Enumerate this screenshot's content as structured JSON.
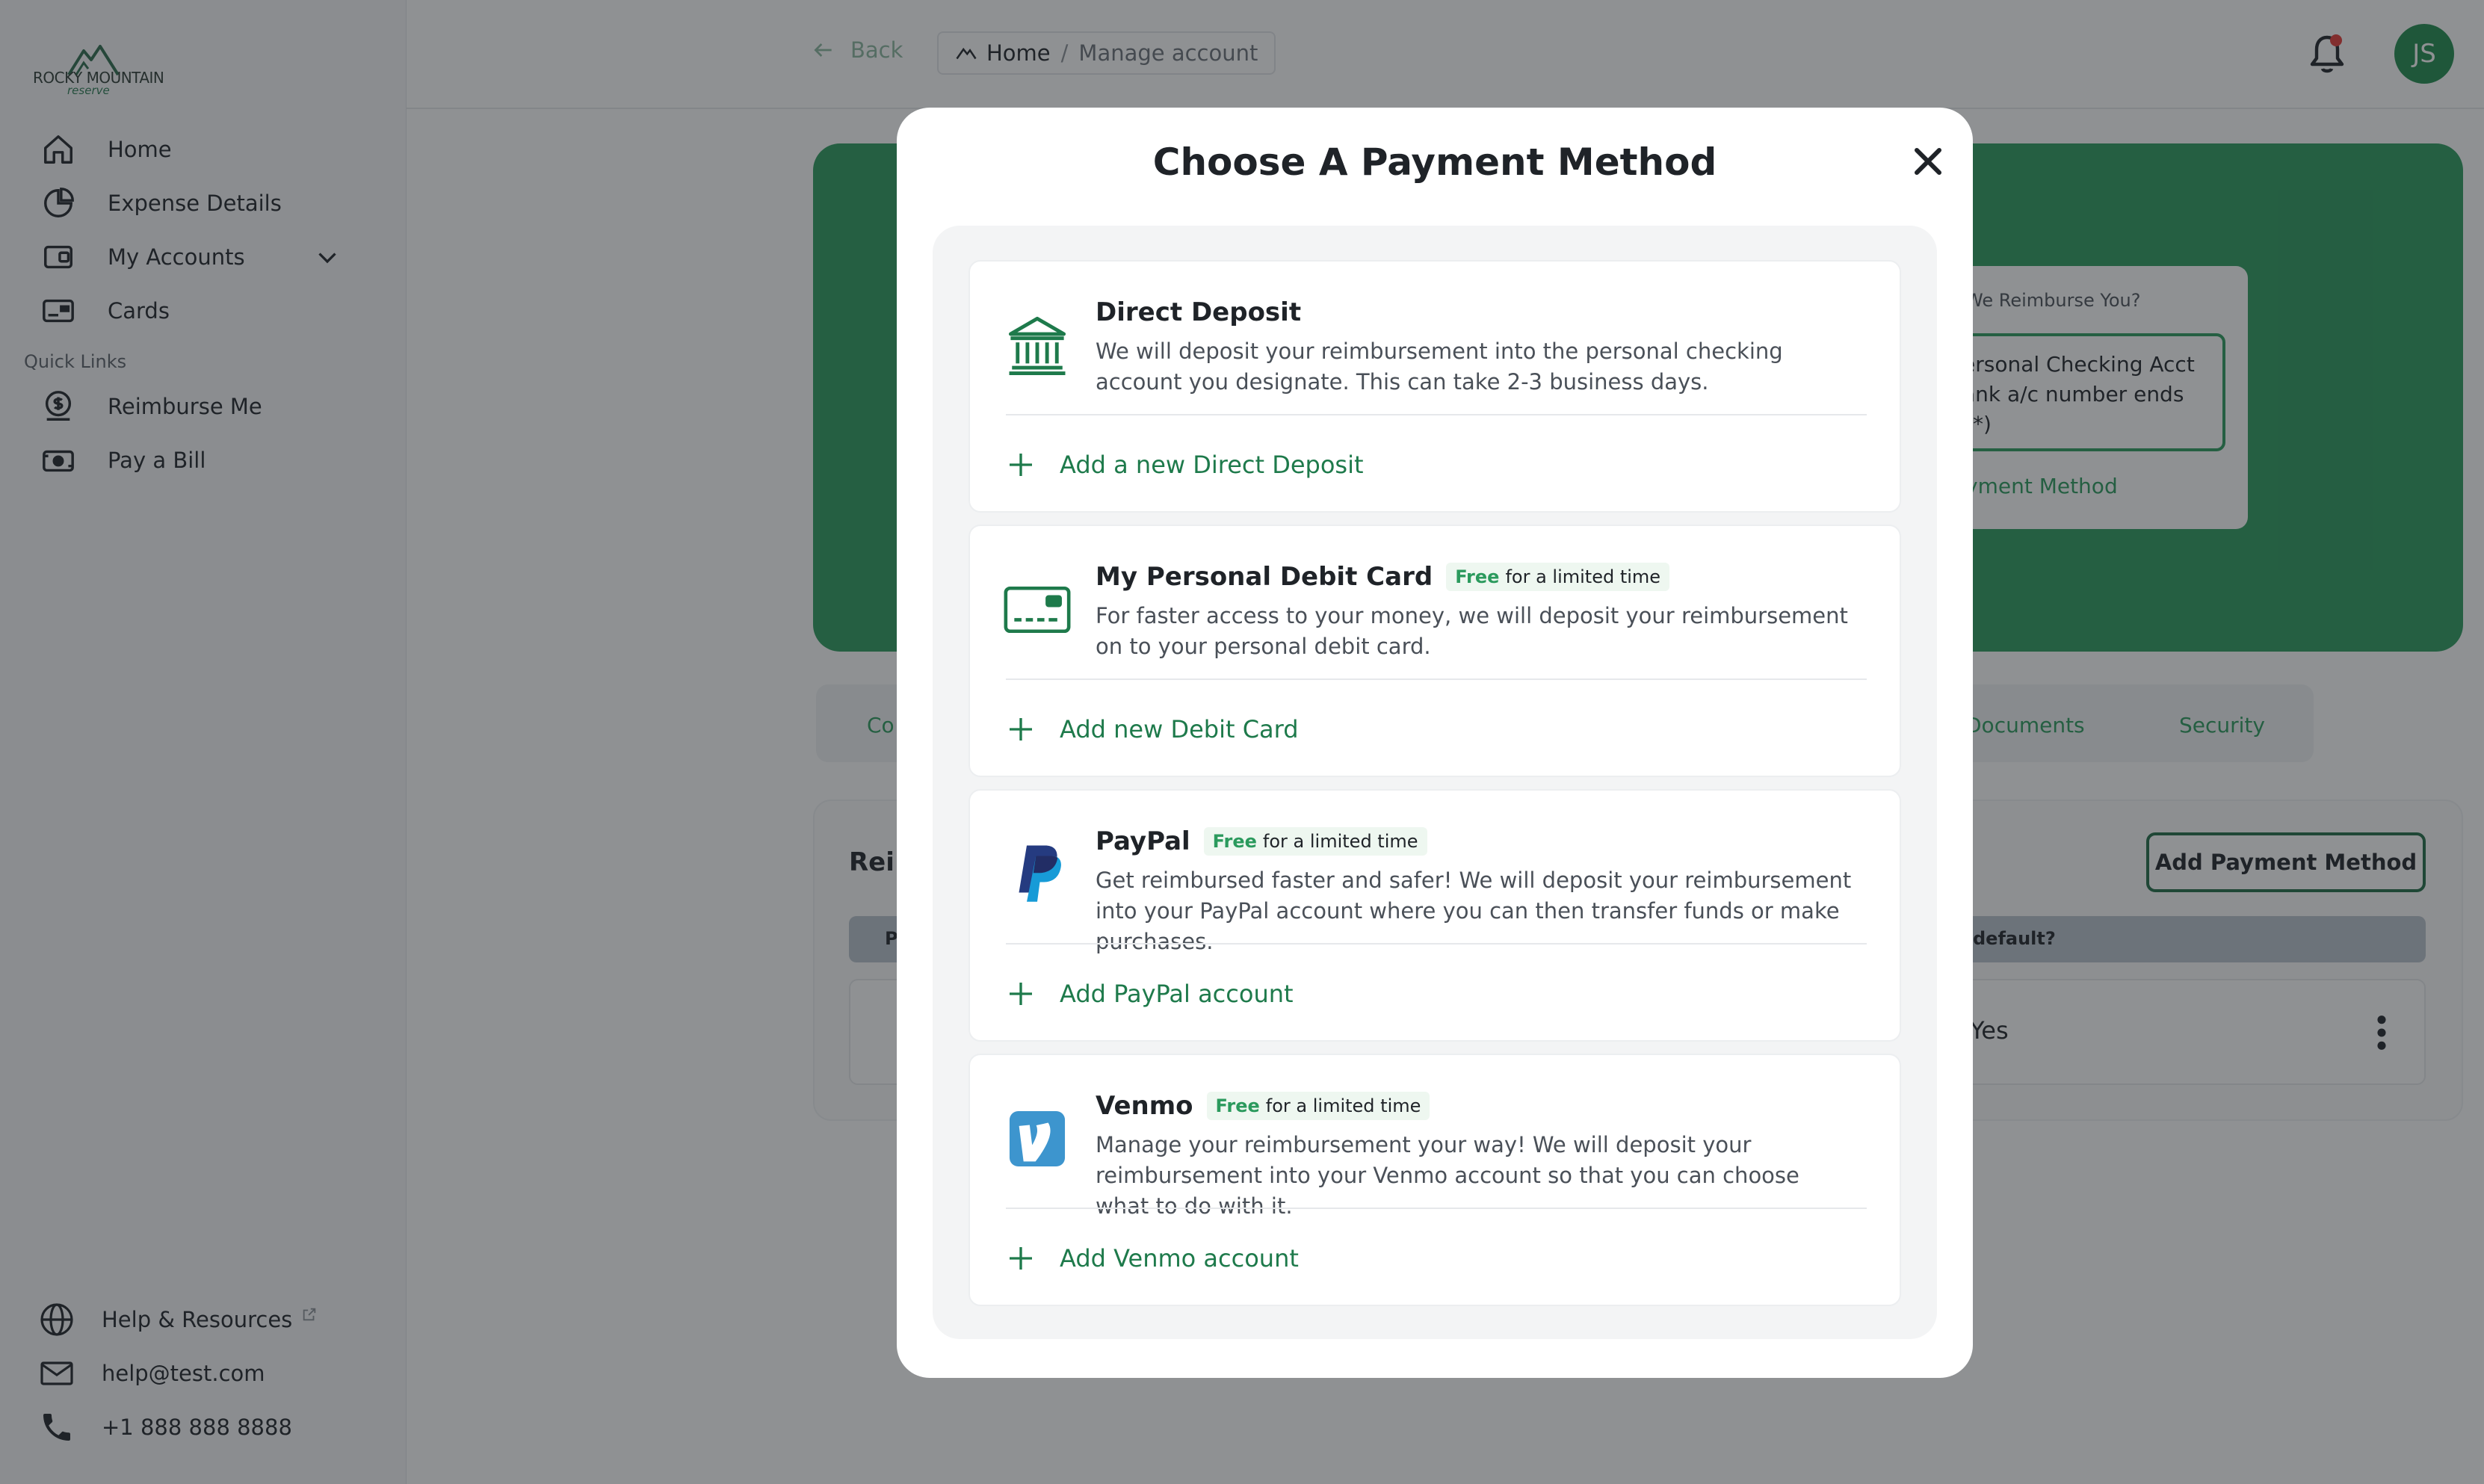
{
  "brand": {
    "name": "ROCKY MOUNTAIN",
    "tagline": "reserve"
  },
  "sidebar": {
    "items": [
      {
        "label": "Home",
        "icon": "home-icon"
      },
      {
        "label": "Expense Details",
        "icon": "pie-chart-icon"
      },
      {
        "label": "My Accounts",
        "icon": "wallet-icon"
      },
      {
        "label": "Cards",
        "icon": "card-icon"
      }
    ],
    "quick_links_title": "Quick Links",
    "quick_links": [
      {
        "label": "Reimburse Me",
        "icon": "dollar-coin-icon"
      },
      {
        "label": "Pay a Bill",
        "icon": "bill-icon"
      }
    ],
    "bottom": [
      {
        "label": "Help & Resources",
        "icon": "globe-icon"
      },
      {
        "label": "help@test.com",
        "icon": "mail-icon"
      },
      {
        "label": "+1 888 888 8888",
        "icon": "phone-icon"
      }
    ]
  },
  "topbar": {
    "back_label": "Back",
    "breadcrumb": {
      "home": "Home",
      "separator": "/",
      "current": "Manage account"
    },
    "avatar_initials": "JS"
  },
  "background": {
    "hero_question": "We Reimburse You?",
    "hero_account": "ersonal Checking Acct ank a/c number ends **)",
    "hero_link": "yment Method",
    "tabs": [
      "Co",
      "Documents",
      "Security"
    ],
    "panel_title": "Rei",
    "add_payment_button": "Add Payment Method",
    "table_header_left": "P",
    "table_header_default": "default?",
    "row_default_value": "Yes"
  },
  "modal": {
    "title": "Choose A Payment Method",
    "options": [
      {
        "name": "Direct Deposit",
        "badge": null,
        "description": "We will deposit your reimbursement into the personal checking account you designate. This can take 2-3 business days.",
        "add_label": "Add a new Direct Deposit",
        "icon": "bank-icon"
      },
      {
        "name": "My Personal Debit Card",
        "badge": {
          "free": "Free",
          "rest": "for a limited time"
        },
        "description": "For faster access to your money, we will deposit your reimbursement on to your personal debit card.",
        "add_label": "Add new Debit Card",
        "icon": "debit-card-icon"
      },
      {
        "name": "PayPal",
        "badge": {
          "free": "Free",
          "rest": "for a limited time"
        },
        "description": "Get reimbursed faster and safer! We will deposit your reimbursement into your PayPal account where you can then transfer funds or make purchases.",
        "add_label": "Add PayPal account",
        "icon": "paypal-icon"
      },
      {
        "name": "Venmo",
        "badge": {
          "free": "Free",
          "rest": "for a limited time"
        },
        "description": "Manage your reimbursement your way! We will deposit your reimbursement into your Venmo account so that you can choose what to do with it.",
        "add_label": "Add Venmo account",
        "icon": "venmo-icon"
      }
    ]
  },
  "colors": {
    "brand_green": "#2b9a5d",
    "dark_green": "#1e7a4b",
    "notification": "#e53935",
    "paypal_dark": "#253b80",
    "paypal_light": "#179bd7",
    "venmo": "#3d95ce"
  }
}
